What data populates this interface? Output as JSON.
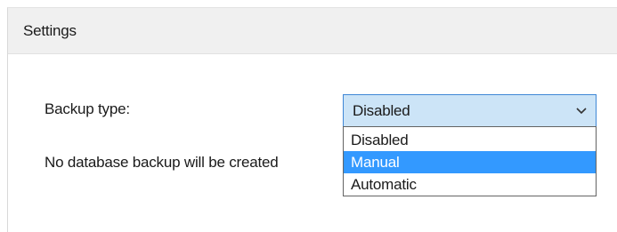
{
  "group": {
    "title": "Settings"
  },
  "form": {
    "backup_type_label": "Backup type:",
    "status_text": "No database backup will be created"
  },
  "combo": {
    "selected_value": "Disabled",
    "arrow_icon": "chevron-down-icon",
    "colors": {
      "focus_border": "#3f87d6",
      "focus_fill": "#cce4f7",
      "highlight": "#3399ff"
    }
  },
  "dropdown": {
    "options": [
      {
        "label": "Disabled",
        "highlighted": false
      },
      {
        "label": "Manual",
        "highlighted": true
      },
      {
        "label": "Automatic",
        "highlighted": false
      }
    ]
  }
}
